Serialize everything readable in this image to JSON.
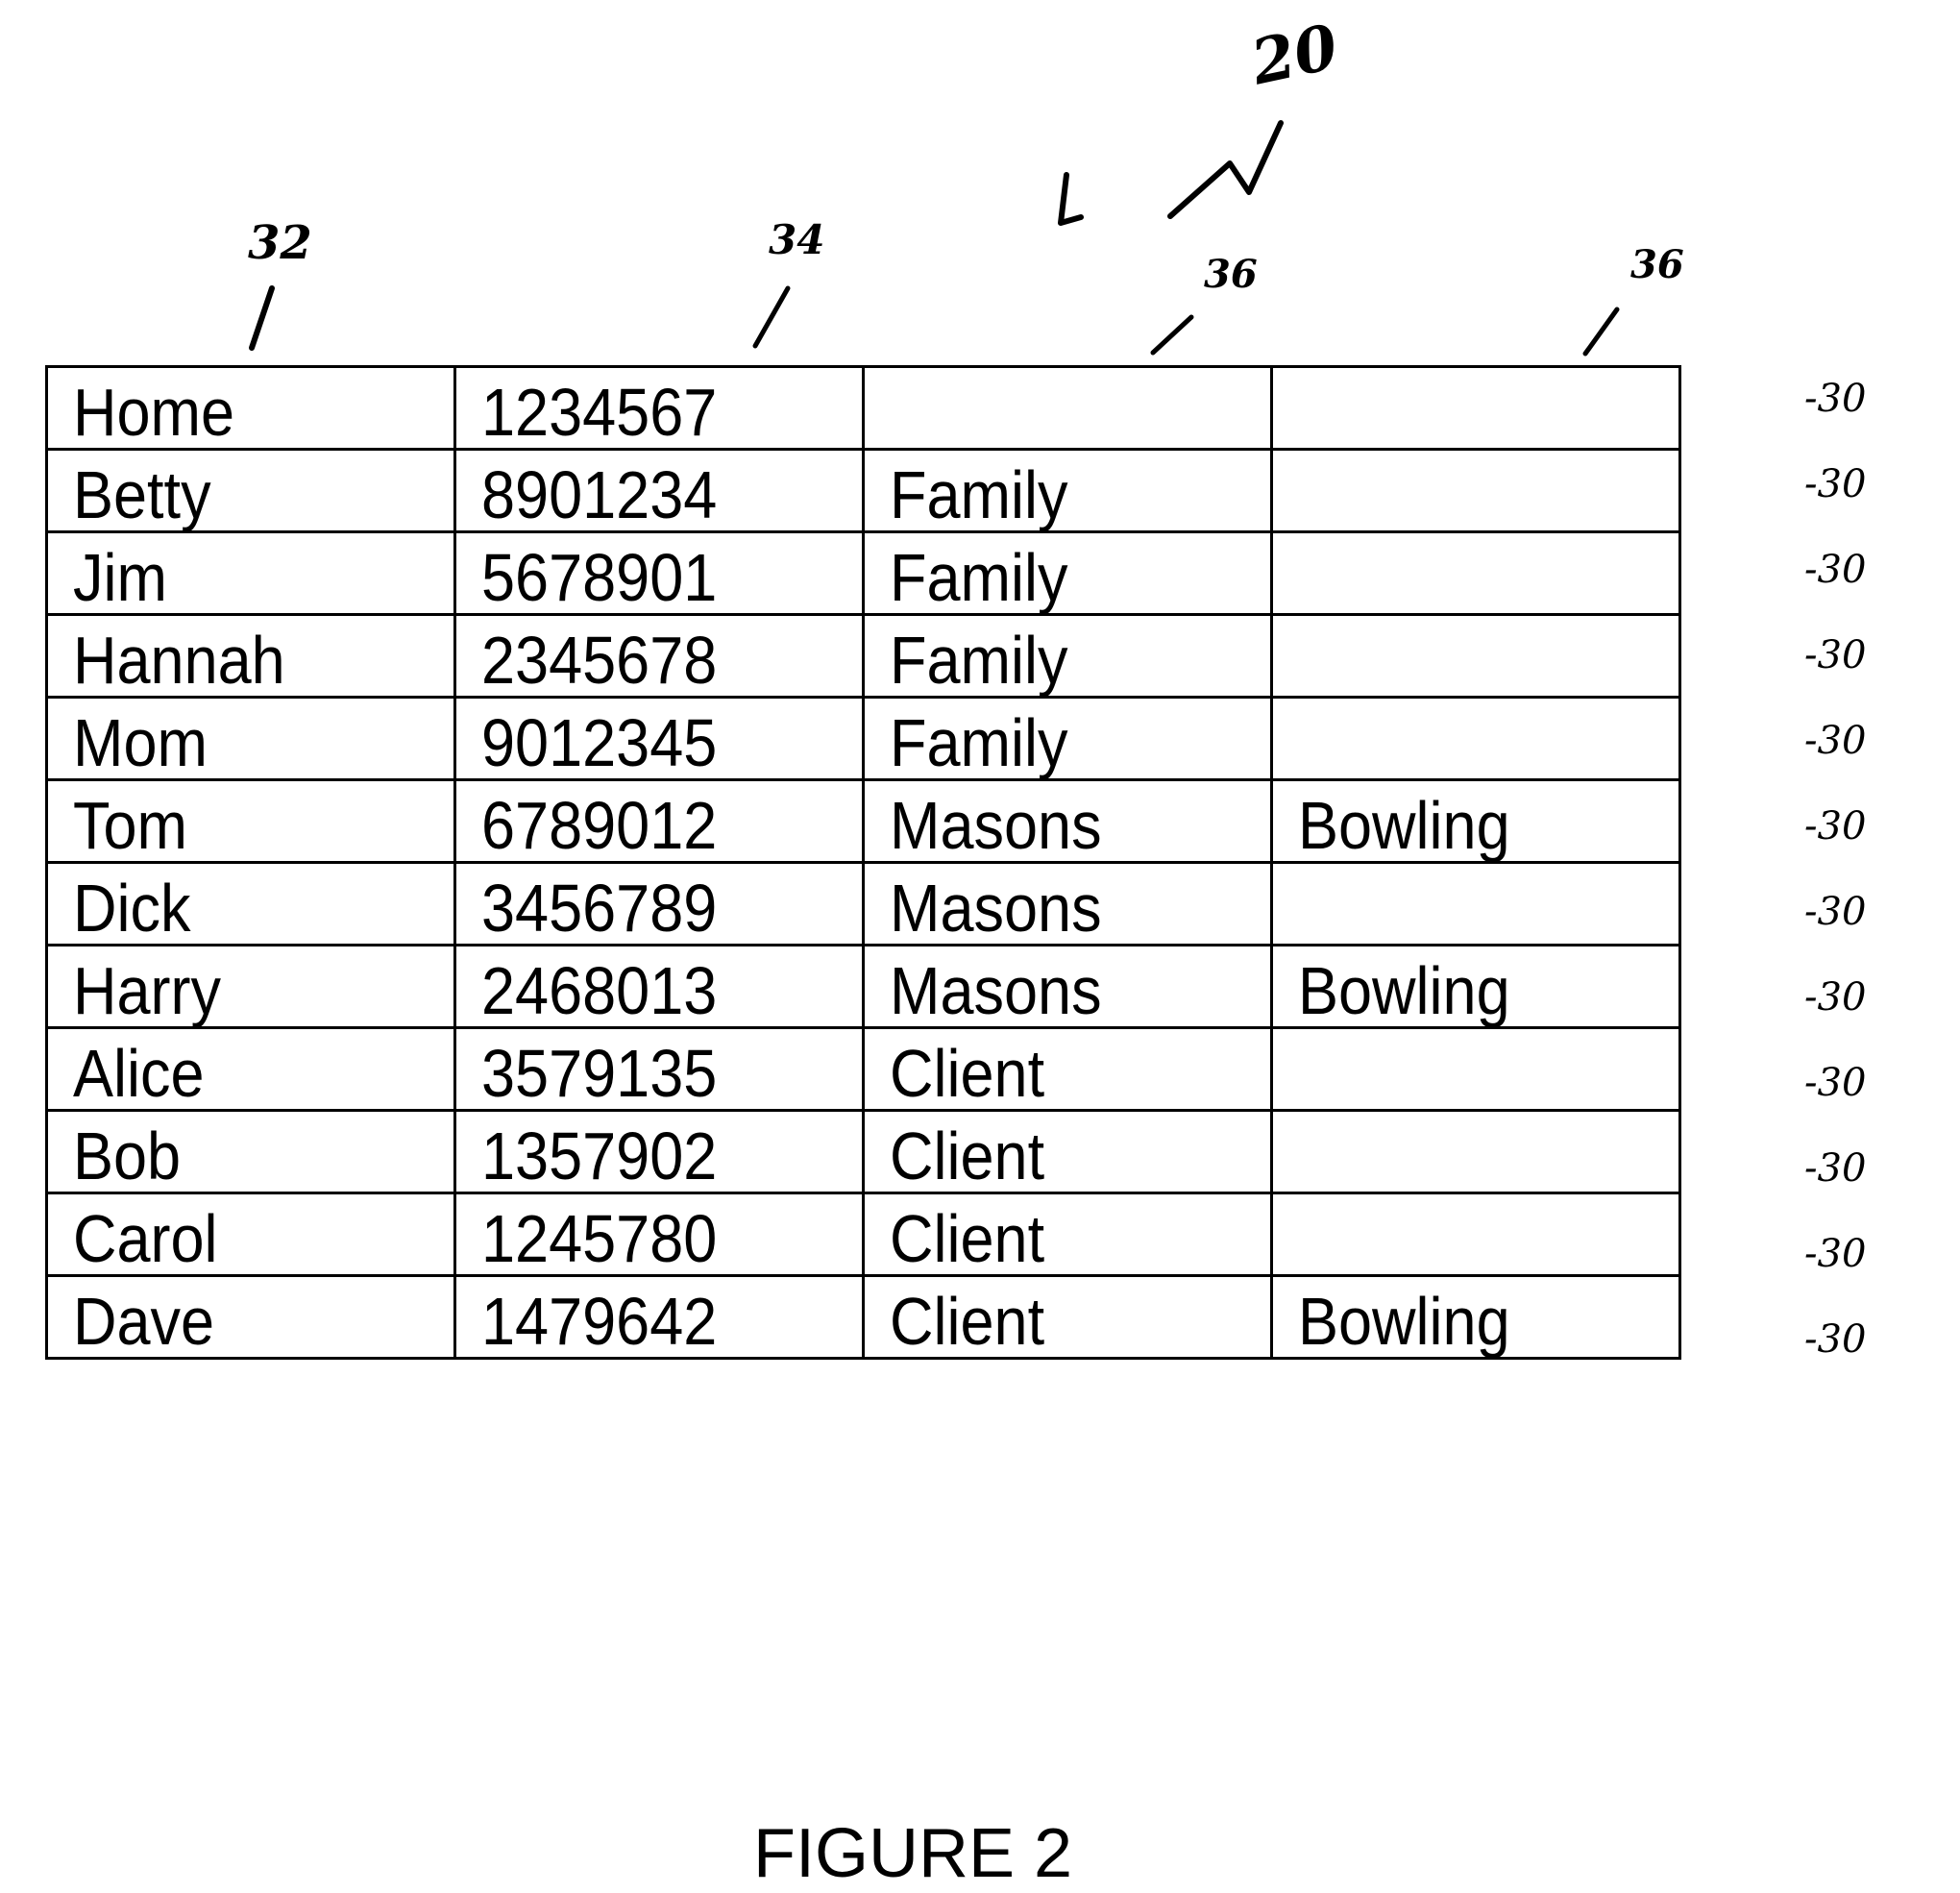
{
  "figure": {
    "caption": "FIGURE 2",
    "reference_numerals": {
      "table": "20",
      "name_column": "32",
      "number_column": "34",
      "group_column_1": "36",
      "group_column_2": "36",
      "row": "-30"
    }
  },
  "table": {
    "rows": [
      {
        "name": "Home",
        "number": "1234567",
        "group1": "",
        "group2": ""
      },
      {
        "name": "Betty",
        "number": "8901234",
        "group1": "Family",
        "group2": ""
      },
      {
        "name": "Jim",
        "number": "5678901",
        "group1": "Family",
        "group2": ""
      },
      {
        "name": "Hannah",
        "number": "2345678",
        "group1": "Family",
        "group2": ""
      },
      {
        "name": "Mom",
        "number": "9012345",
        "group1": "Family",
        "group2": ""
      },
      {
        "name": "Tom",
        "number": "6789012",
        "group1": "Masons",
        "group2": "Bowling"
      },
      {
        "name": "Dick",
        "number": "3456789",
        "group1": "Masons",
        "group2": ""
      },
      {
        "name": "Harry",
        "number": "2468013",
        "group1": "Masons",
        "group2": "Bowling"
      },
      {
        "name": "Alice",
        "number": "3579135",
        "group1": "Client",
        "group2": ""
      },
      {
        "name": "Bob",
        "number": "1357902",
        "group1": "Client",
        "group2": ""
      },
      {
        "name": "Carol",
        "number": "1245780",
        "group1": "Client",
        "group2": ""
      },
      {
        "name": "Dave",
        "number": "1479642",
        "group1": "Client",
        "group2": "Bowling"
      }
    ]
  }
}
